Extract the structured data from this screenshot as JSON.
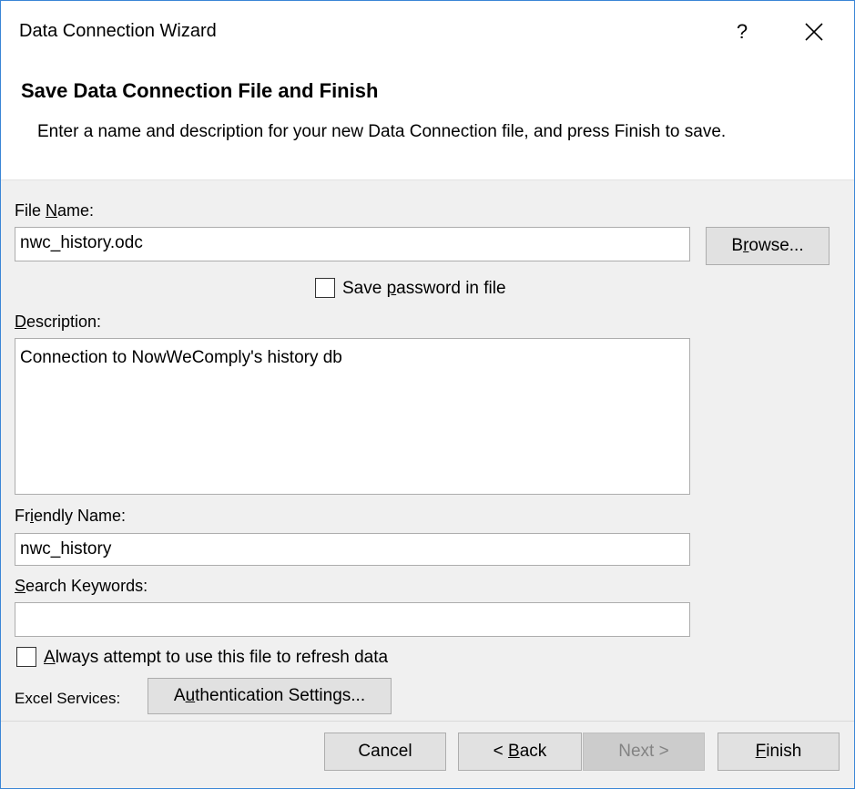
{
  "window": {
    "title": "Data Connection Wizard",
    "help_label": "?"
  },
  "header": {
    "title": "Save Data Connection File and Finish",
    "description": "Enter a name and description for your new Data Connection file, and press Finish to save."
  },
  "file_name": {
    "label_pre": "File ",
    "label_mnemonic": "N",
    "label_post": "ame:",
    "value": "nwc_history.odc",
    "browse_pre": "B",
    "browse_mnemonic": "r",
    "browse_post": "owse..."
  },
  "save_password": {
    "label_pre": "Save ",
    "label_mnemonic": "p",
    "label_post": "assword in file",
    "checked": false
  },
  "description": {
    "label_pre": "",
    "label_mnemonic": "D",
    "label_post": "escription:",
    "value": "Connection to NowWeComply's history db"
  },
  "friendly_name": {
    "label_pre": "Fr",
    "label_mnemonic": "i",
    "label_post": "endly Name:",
    "value": "nwc_history"
  },
  "search_keywords": {
    "label_pre": "",
    "label_mnemonic": "S",
    "label_post": "earch Keywords:",
    "value": ""
  },
  "always_refresh": {
    "label_pre": "",
    "label_mnemonic": "A",
    "label_post": "lways attempt to use this file to refresh data",
    "checked": false
  },
  "excel_services": {
    "label": "Excel Services:",
    "auth_pre": "A",
    "auth_mnemonic": "u",
    "auth_post": "thentication Settings..."
  },
  "footer": {
    "cancel": "Cancel",
    "back_pre": "< ",
    "back_mnemonic": "B",
    "back_post": "ack",
    "next": "Next >",
    "finish_pre": "",
    "finish_mnemonic": "F",
    "finish_post": "inish"
  }
}
